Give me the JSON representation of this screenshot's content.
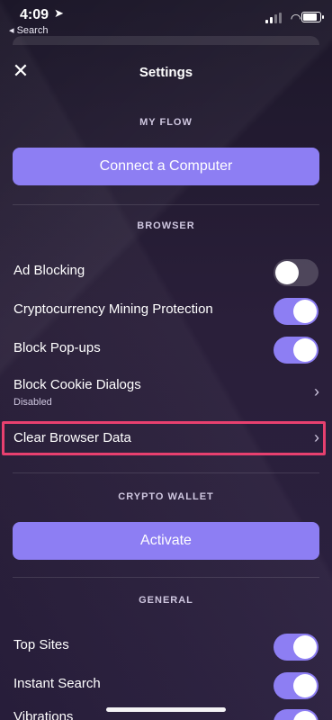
{
  "status_bar": {
    "time": "4:09",
    "back_label": "◂ Search"
  },
  "header": {
    "title": "Settings",
    "close_icon": "close-icon"
  },
  "sections": {
    "my_flow": "MY FLOW",
    "browser": "BROWSER",
    "crypto_wallet": "CRYPTO WALLET",
    "general": "GENERAL"
  },
  "buttons": {
    "connect_computer": "Connect a Computer",
    "activate": "Activate"
  },
  "browser_items": {
    "ad_blocking": {
      "label": "Ad Blocking",
      "enabled": false
    },
    "crypto_mining": {
      "label": "Cryptocurrency Mining Protection",
      "enabled": true
    },
    "block_popups": {
      "label": "Block Pop-ups",
      "enabled": true
    },
    "cookie_dialogs": {
      "label": "Block Cookie Dialogs",
      "subtext": "Disabled"
    },
    "clear_data": {
      "label": "Clear Browser Data"
    }
  },
  "general_items": {
    "top_sites": {
      "label": "Top Sites",
      "enabled": true
    },
    "instant_search": {
      "label": "Instant Search",
      "enabled": true
    },
    "partially_visible": {
      "label": "Vibrations"
    }
  },
  "colors": {
    "accent": "#8d7ef3",
    "highlight": "#e8406f",
    "background": "#2a1d3a"
  }
}
